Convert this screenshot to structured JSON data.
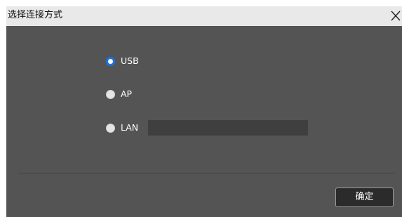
{
  "dialog": {
    "title": "选择连接方式",
    "close_icon": "close-icon",
    "options": [
      {
        "label": "USB",
        "checked": true
      },
      {
        "label": "AP",
        "checked": false
      },
      {
        "label": "LAN",
        "checked": false
      }
    ],
    "lan_input": {
      "value": "",
      "placeholder": ""
    },
    "confirm_label": "确定"
  },
  "colors": {
    "dialog_bg": "#545454",
    "titlebar_bg": "#e9e9e9",
    "radio_accent": "#1a73e8",
    "input_bg": "#3f3f3f",
    "button_bg": "#2b2b2b"
  }
}
